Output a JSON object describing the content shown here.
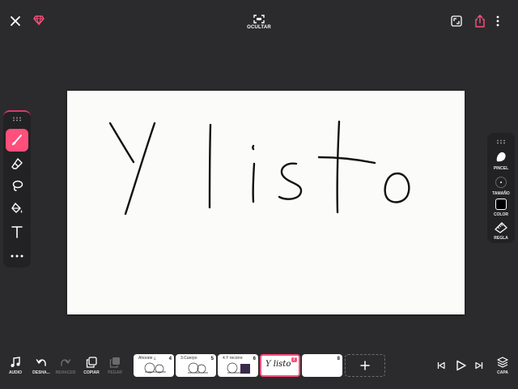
{
  "topbar": {
    "hide_label": "OCULTAR"
  },
  "canvas": {
    "handwritten_text": "Y listo"
  },
  "right_toolbar": {
    "brush_label": "PINCEL",
    "size_label": "TAMAÑO",
    "color_label": "COLOR",
    "ruler_label": "REGLA"
  },
  "bottom_bar": {
    "audio_label": "AUDIO",
    "undo_label": "DESHA...",
    "redo_label": "REHACER",
    "copy_label": "COPIAR",
    "paste_label": "PEGAR",
    "layer_label": "CAPA"
  },
  "frames": [
    {
      "number": "4",
      "text": "Ahorate  ¿"
    },
    {
      "number": "5",
      "text": "3.Cuerpo"
    },
    {
      "number": "6",
      "text": "4.Y recorre"
    },
    {
      "number": "7",
      "text": "Y listo"
    },
    {
      "number": "8",
      "text": ""
    }
  ],
  "colors": {
    "accent": "#ff4f7b",
    "background": "#2b2b2d",
    "panel": "#222224",
    "current_color": "#000000"
  },
  "icons": [
    "close-icon",
    "diamond-icon",
    "hide-icon",
    "fullscreen-icon",
    "share-icon",
    "more-vertical-icon",
    "brush-icon",
    "eraser-icon",
    "lasso-icon",
    "fill-bucket-icon",
    "text-icon",
    "more-horizontal-icon",
    "music-note-icon",
    "undo-icon",
    "redo-icon",
    "copy-icon",
    "paste-icon",
    "skip-back-icon",
    "play-icon",
    "skip-forward-icon",
    "layers-icon",
    "plus-icon"
  ]
}
